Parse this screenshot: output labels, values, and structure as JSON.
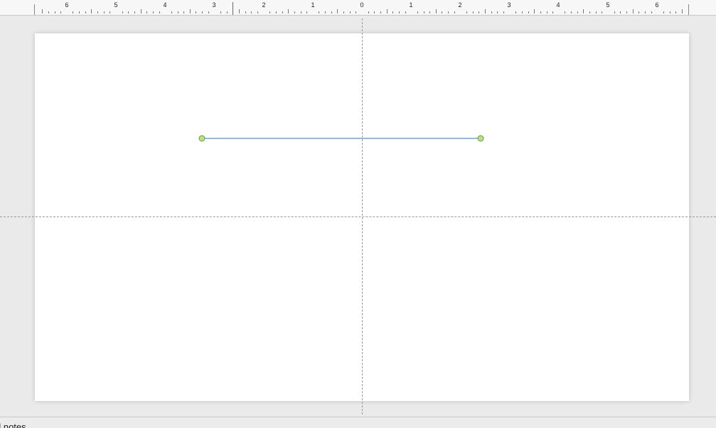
{
  "ruler": {
    "labels": [
      "6",
      "5",
      "4",
      "3",
      "2",
      "1",
      "0",
      "1",
      "2",
      "3",
      "4",
      "5",
      "6"
    ]
  },
  "slide": {
    "line_shape": {
      "stroke_color": "#3f6fa8",
      "handle_fill": "#b9e08a",
      "handle_stroke": "#6a9a3a"
    }
  },
  "notes": {
    "label": "d notes"
  },
  "colors": {
    "workspace": "#eaeaea",
    "slide": "#ffffff",
    "guide": "#9a9a9a"
  }
}
